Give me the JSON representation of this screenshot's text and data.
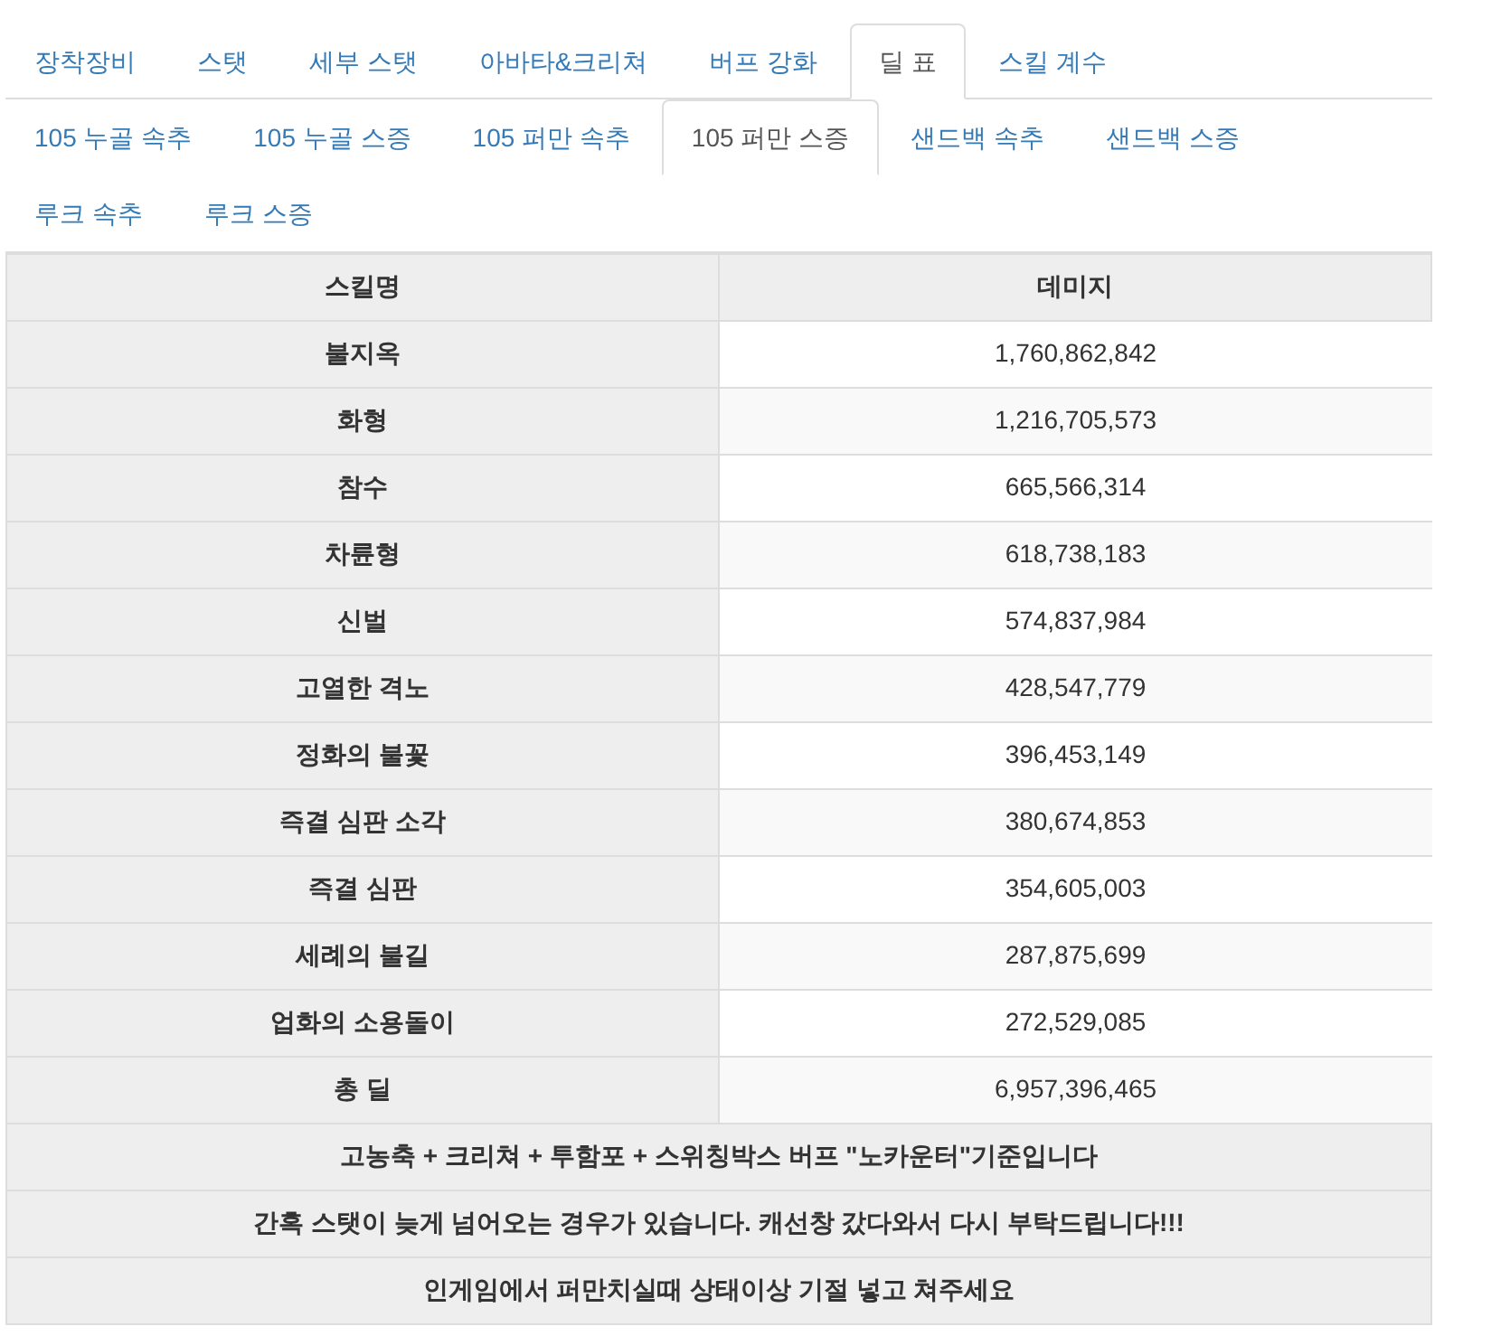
{
  "tabs": [
    {
      "label": "장착장비",
      "selected": false
    },
    {
      "label": "스탯",
      "selected": false
    },
    {
      "label": "세부 스탯",
      "selected": false
    },
    {
      "label": "아바타&크리쳐",
      "selected": false
    },
    {
      "label": "버프 강화",
      "selected": false
    },
    {
      "label": "딜 표",
      "selected": true
    },
    {
      "label": "스킬 계수",
      "selected": false
    }
  ],
  "sub_tabs": [
    {
      "label": "105 누골 속추",
      "selected": false
    },
    {
      "label": "105 누골 스증",
      "selected": false
    },
    {
      "label": "105 퍼만 속추",
      "selected": false
    },
    {
      "label": "105 퍼만 스증",
      "selected": true
    },
    {
      "label": "샌드백 속추",
      "selected": false
    },
    {
      "label": "샌드백 스증",
      "selected": false
    },
    {
      "label": "루크 속추",
      "selected": false
    },
    {
      "label": "루크 스증",
      "selected": false
    }
  ],
  "table": {
    "columns": [
      "스킬명",
      "데미지"
    ],
    "rows": [
      [
        "불지옥",
        "1,760,862,842"
      ],
      [
        "화형",
        "1,216,705,573"
      ],
      [
        "참수",
        "665,566,314"
      ],
      [
        "차륜형",
        "618,738,183"
      ],
      [
        "신벌",
        "574,837,984"
      ],
      [
        "고열한 격노",
        "428,547,779"
      ],
      [
        "정화의 불꽃",
        "396,453,149"
      ],
      [
        "즉결 심판 소각",
        "380,674,853"
      ],
      [
        "즉결 심판",
        "354,605,003"
      ],
      [
        "세례의 불길",
        "287,875,699"
      ],
      [
        "업화의 소용돌이",
        "272,529,085"
      ],
      [
        "총 딜",
        "6,957,396,465"
      ]
    ],
    "notes": [
      "고농축 + 크리쳐 + 투함포 + 스위칭박스 버프 \"노카운터\"기준입니다",
      "간혹 스탯이 늦게 넘어오는 경우가 있습니다. 캐선창 갔다와서 다시 부탁드립니다!!!",
      "인게임에서 퍼만치실때 상태이상 기절 넣고 쳐주세요"
    ]
  }
}
